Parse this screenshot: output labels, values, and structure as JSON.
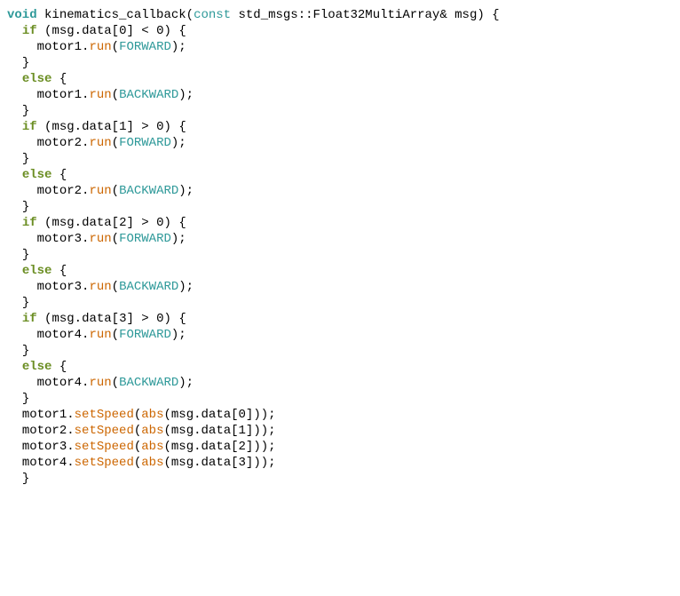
{
  "line1": {
    "void": "void",
    "fname": "kinematics_callback",
    "p1": "(",
    "const": "const",
    "type": "std_msgs::Float32MultiArray",
    "amp": "&",
    "param": "msg",
    "p2": ") {"
  },
  "line2": {
    "if": "if",
    "p1": "(",
    "msg": "msg",
    "dot": ".",
    "data": "data",
    "idx": "[0]",
    "op": "<",
    "zero": "0",
    "p2": ") {"
  },
  "line3": {
    "motor": "motor1",
    "dot": ".",
    "run": "run",
    "p1": "(",
    "dir": "FORWARD",
    "p2": ");"
  },
  "line4": {
    "brace": "}"
  },
  "line5": {
    "else": "else",
    "brace": "{"
  },
  "line6": {
    "motor": "motor1",
    "dot": ".",
    "run": "run",
    "p1": "(",
    "dir": "BACKWARD",
    "p2": ");"
  },
  "line7": {
    "brace": "}"
  },
  "line8": {
    "if": "if",
    "p1": "(",
    "msg": "msg",
    "dot": ".",
    "data": "data",
    "idx": "[1]",
    "op": ">",
    "zero": "0",
    "p2": ") {"
  },
  "line9": {
    "motor": "motor2",
    "dot": ".",
    "run": "run",
    "p1": "(",
    "dir": "FORWARD",
    "p2": ");"
  },
  "line10": {
    "brace": "}"
  },
  "line11": {
    "else": "else",
    "brace": "{"
  },
  "line12": {
    "motor": "motor2",
    "dot": ".",
    "run": "run",
    "p1": "(",
    "dir": "BACKWARD",
    "p2": ");"
  },
  "line13": {
    "brace": "}"
  },
  "line14": {
    "if": "if",
    "p1": "(",
    "msg": "msg",
    "dot": ".",
    "data": "data",
    "idx": "[2]",
    "op": ">",
    "zero": "0",
    "p2": ") {"
  },
  "line15": {
    "motor": "motor3",
    "dot": ".",
    "run": "run",
    "p1": "(",
    "dir": "FORWARD",
    "p2": ");"
  },
  "line16": {
    "brace": "}"
  },
  "line17": {
    "else": "else",
    "brace": "{"
  },
  "line18": {
    "motor": "motor3",
    "dot": ".",
    "run": "run",
    "p1": "(",
    "dir": "BACKWARD",
    "p2": ");"
  },
  "line19": {
    "brace": "}"
  },
  "line20": {
    "if": "if",
    "p1": "(",
    "msg": "msg",
    "dot": ".",
    "data": "data",
    "idx": "[3]",
    "op": ">",
    "zero": "0",
    "p2": ") {"
  },
  "line21": {
    "motor": "motor4",
    "dot": ".",
    "run": "run",
    "p1": "(",
    "dir": "FORWARD",
    "p2": ");"
  },
  "line22": {
    "brace": "}"
  },
  "line23": {
    "else": "else",
    "brace": "{"
  },
  "line24": {
    "motor": "motor4",
    "dot": ".",
    "run": "run",
    "p1": "(",
    "dir": "BACKWARD",
    "p2": ");"
  },
  "line25": {
    "brace": "}"
  },
  "line26": {
    "motor": "motor1",
    "dot": ".",
    "set": "setSpeed",
    "p1": "(",
    "abs": "abs",
    "p2": "(",
    "msg": "msg",
    "dot2": ".",
    "data": "data",
    "idx": "[0]",
    "p3": "));"
  },
  "line27": {
    "motor": "motor2",
    "dot": ".",
    "set": "setSpeed",
    "p1": "(",
    "abs": "abs",
    "p2": "(",
    "msg": "msg",
    "dot2": ".",
    "data": "data",
    "idx": "[1]",
    "p3": "));"
  },
  "line28": {
    "motor": "motor3",
    "dot": ".",
    "set": "setSpeed",
    "p1": "(",
    "abs": "abs",
    "p2": "(",
    "msg": "msg",
    "dot2": ".",
    "data": "data",
    "idx": "[2]",
    "p3": "));"
  },
  "line29": {
    "motor": "motor4",
    "dot": ".",
    "set": "setSpeed",
    "p1": "(",
    "abs": "abs",
    "p2": "(",
    "msg": "msg",
    "dot2": ".",
    "data": "data",
    "idx": "[3]",
    "p3": "));"
  },
  "line30": {
    "brace": "}"
  }
}
